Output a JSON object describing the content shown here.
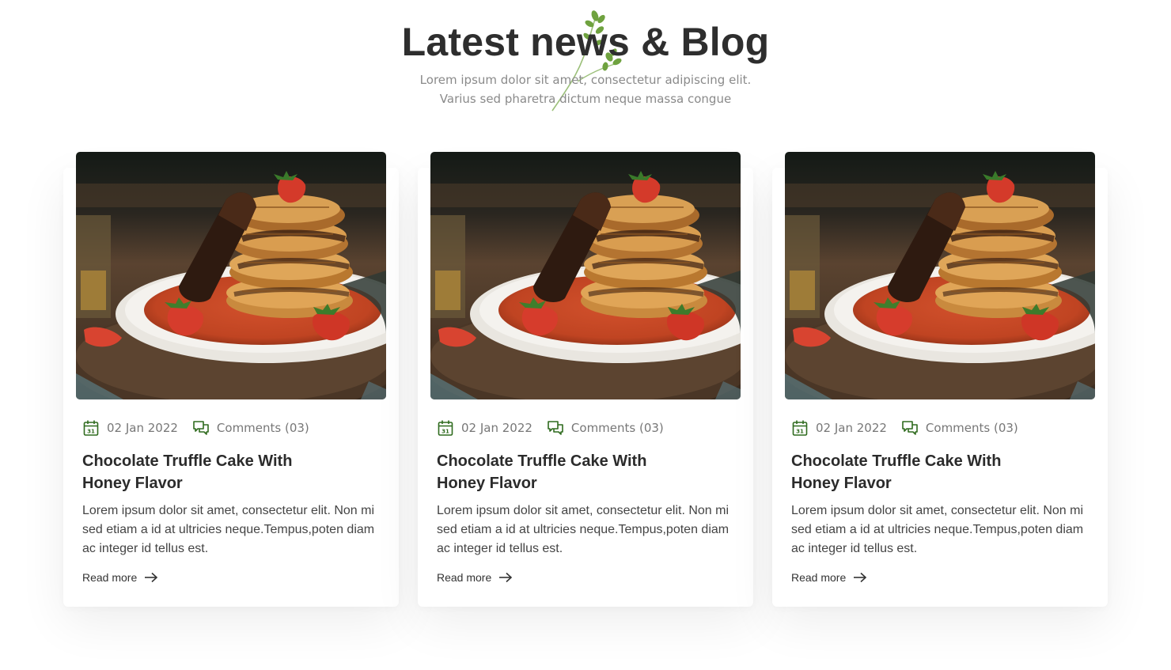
{
  "section": {
    "title": "Latest news & Blog",
    "subtitle_line1": "Lorem ipsum dolor sit amet, consectetur adipiscing elit.",
    "subtitle_line2": "Varius sed pharetra dictum neque massa congue",
    "decoration_icon": "herb-sprig-icon"
  },
  "colors": {
    "accent": "#2f6b1e",
    "heading": "#2e2e2e",
    "muted": "#8a8a8a"
  },
  "posts": [
    {
      "image": "waffles-photo",
      "date": "02 Jan 2022",
      "comments": "Comments (03)",
      "title_line1": "Chocolate Truffle Cake With",
      "title_line2": "Honey Flavor",
      "excerpt": "Lorem ipsum dolor sit amet, consectetur elit. Non mi sed etiam a id at ultricies neque.Tempus,poten diam ac integer id tellus est.",
      "read_more": "Read more"
    },
    {
      "image": "waffles-photo",
      "date": "02 Jan 2022",
      "comments": "Comments (03)",
      "title_line1": "Chocolate Truffle Cake With",
      "title_line2": "Honey Flavor",
      "excerpt": "Lorem ipsum dolor sit amet, consectetur elit. Non mi sed etiam a id at ultricies neque.Tempus,poten diam ac integer id tellus est.",
      "read_more": "Read more"
    },
    {
      "image": "waffles-photo",
      "date": "02 Jan 2022",
      "comments": "Comments (03)",
      "title_line1": "Chocolate Truffle Cake With",
      "title_line2": "Honey Flavor",
      "excerpt": "Lorem ipsum dolor sit amet, consectetur elit. Non mi sed etiam a id at ultricies neque.Tempus,poten diam ac integer id tellus est.",
      "read_more": "Read more"
    }
  ]
}
